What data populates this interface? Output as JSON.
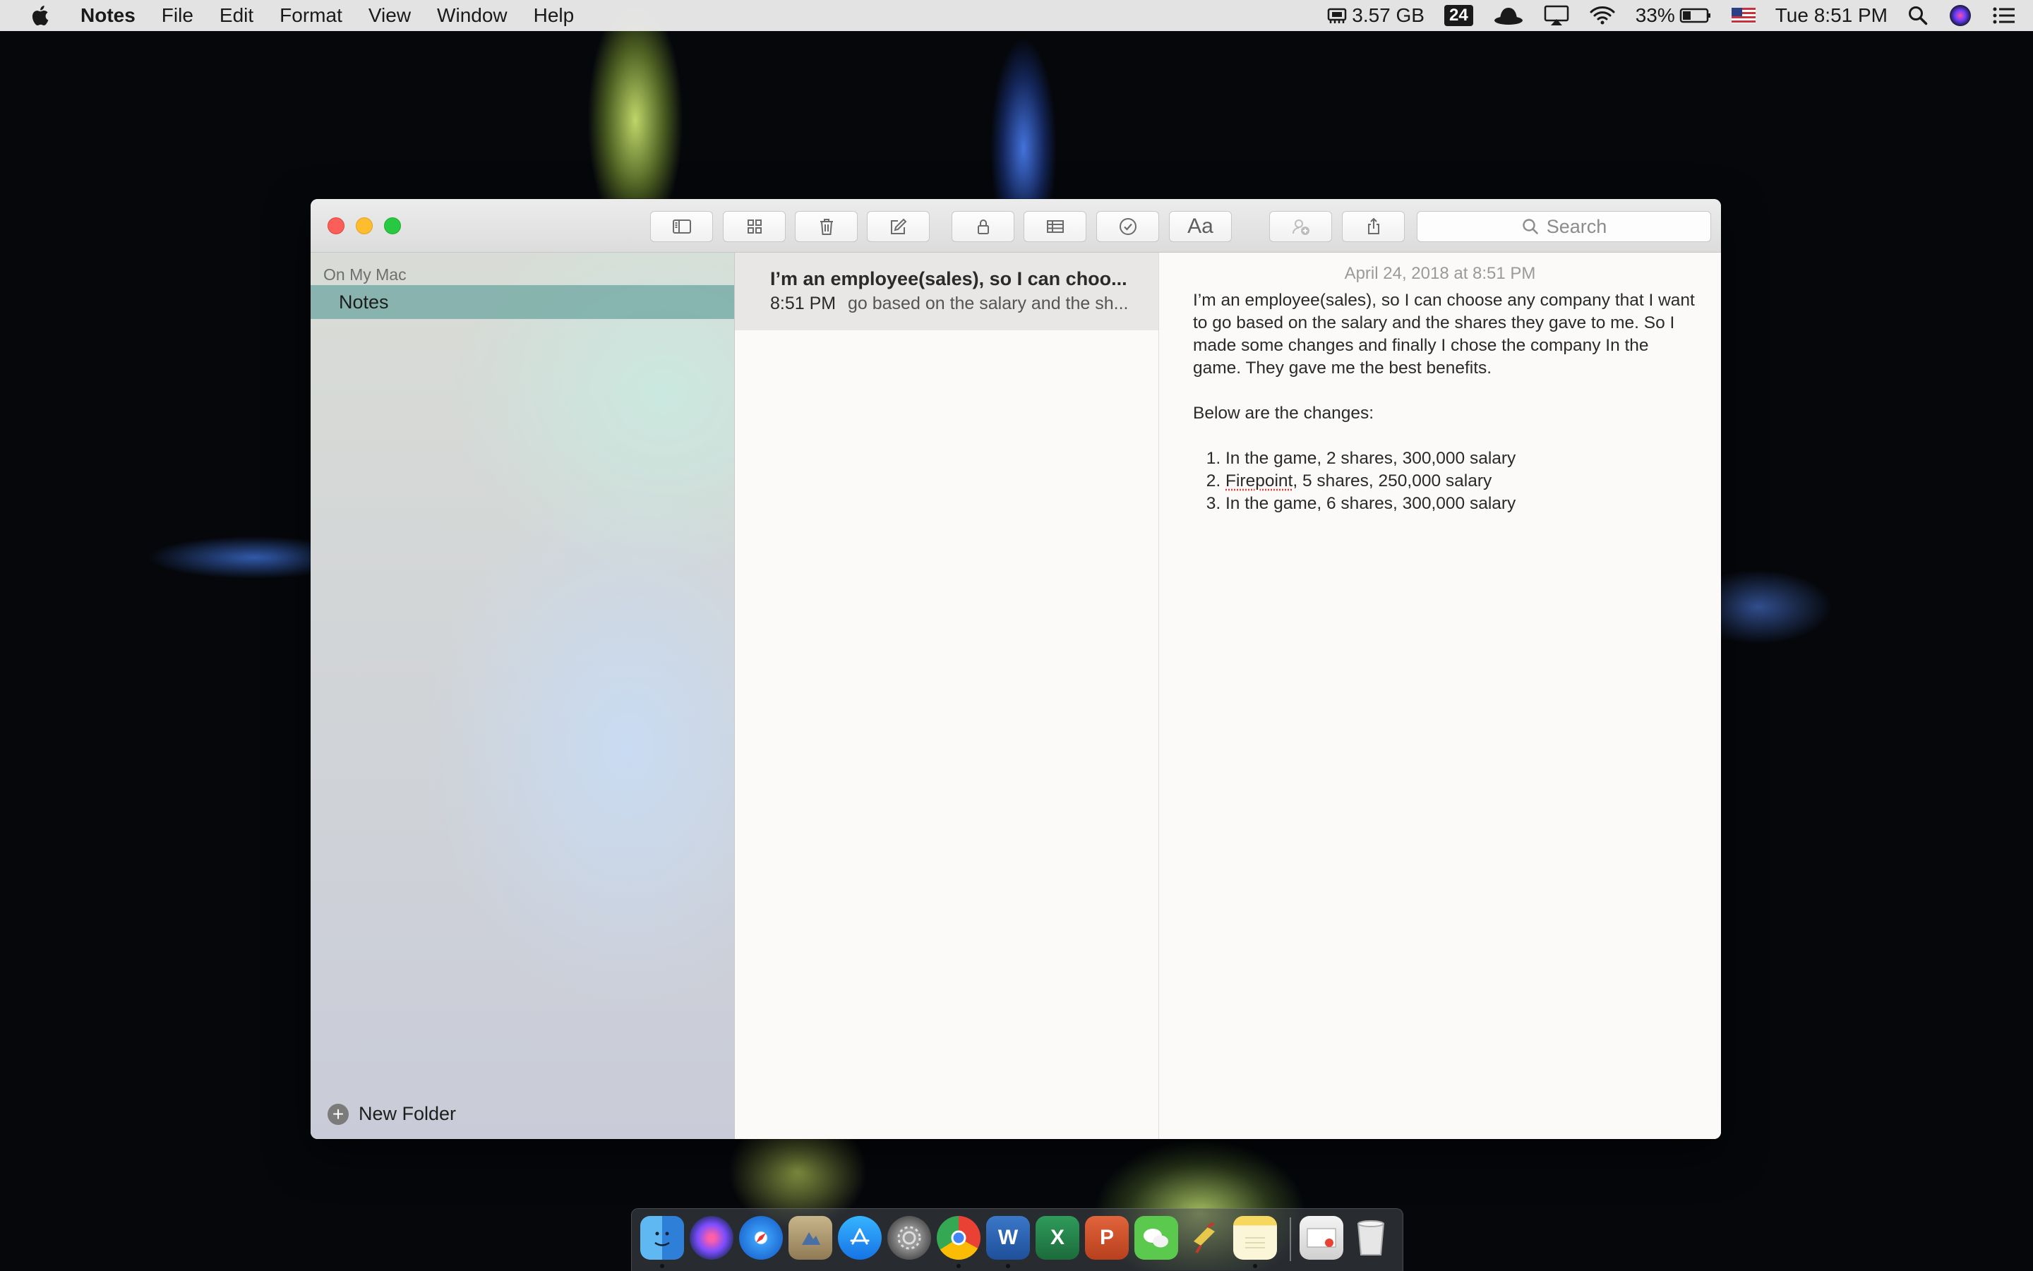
{
  "menubar": {
    "app_name": "Notes",
    "menus": [
      "File",
      "Edit",
      "Format",
      "View",
      "Window",
      "Help"
    ],
    "memory": "3.57 GB",
    "badge": "24",
    "battery": "33%",
    "clock": "Tue 8:51 PM"
  },
  "toolbar": {
    "search_placeholder": "Search"
  },
  "sidebar": {
    "section_header": "On My Mac",
    "selected_folder": "Notes",
    "new_folder_label": "New Folder"
  },
  "note_list": {
    "items": [
      {
        "title": "I’m an employee(sales), so I can choo...",
        "time": "8:51 PM",
        "snippet": "go based on the salary and the sh..."
      }
    ]
  },
  "editor": {
    "date": "April 24, 2018 at 8:51 PM",
    "paragraph1": "I’m an employee(sales), so I can choose any company that I want to go based on the salary and the shares they gave to me. So I made some changes and finally I chose the company In the game. They gave me the best benefits.",
    "paragraph2": "Below are the changes:",
    "list": {
      "item1": "In the game, 2 shares, 300,000 salary",
      "item2_word": "Firepoint",
      "item2_rest": ", 5 shares, 250,000 salary",
      "item3": "In the game, 6 shares, 300,000 salary"
    }
  },
  "dock": {
    "apps": [
      "Finder",
      "Siri",
      "Safari",
      "Preview",
      "App Store",
      "System Preferences",
      "Chrome",
      "Word",
      "Excel",
      "PowerPoint",
      "WeChat",
      "Drop Tool",
      "Notes",
      "Screenshot",
      "Trash"
    ],
    "excel_letter": "X",
    "powerpoint_letter": "P",
    "word_letter": "W"
  },
  "colors": {
    "sidebar_selection": "#6ea5a0",
    "close": "#fc5f57",
    "minimize": "#fdbd2e",
    "zoom": "#28c940"
  }
}
